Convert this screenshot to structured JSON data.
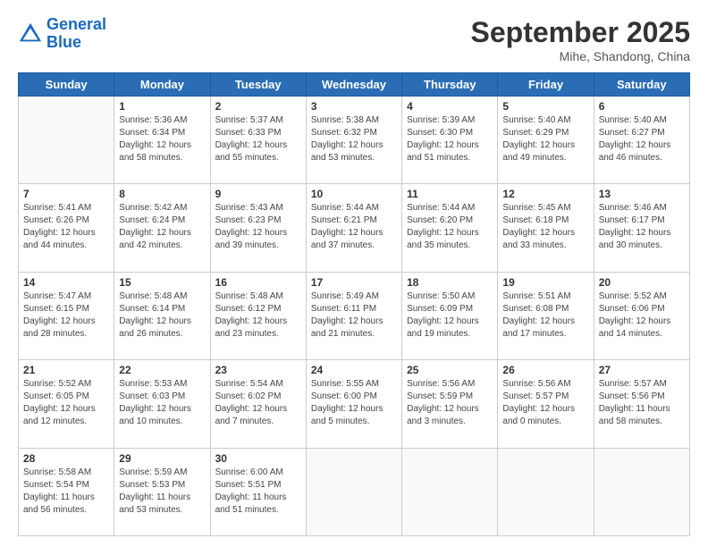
{
  "logo": {
    "line1": "General",
    "line2": "Blue"
  },
  "header": {
    "month": "September 2025",
    "location": "Mihe, Shandong, China"
  },
  "weekdays": [
    "Sunday",
    "Monday",
    "Tuesday",
    "Wednesday",
    "Thursday",
    "Friday",
    "Saturday"
  ],
  "weeks": [
    [
      {
        "day": "",
        "sunrise": "",
        "sunset": "",
        "daylight": ""
      },
      {
        "day": "1",
        "sunrise": "Sunrise: 5:36 AM",
        "sunset": "Sunset: 6:34 PM",
        "daylight": "Daylight: 12 hours and 58 minutes."
      },
      {
        "day": "2",
        "sunrise": "Sunrise: 5:37 AM",
        "sunset": "Sunset: 6:33 PM",
        "daylight": "Daylight: 12 hours and 55 minutes."
      },
      {
        "day": "3",
        "sunrise": "Sunrise: 5:38 AM",
        "sunset": "Sunset: 6:32 PM",
        "daylight": "Daylight: 12 hours and 53 minutes."
      },
      {
        "day": "4",
        "sunrise": "Sunrise: 5:39 AM",
        "sunset": "Sunset: 6:30 PM",
        "daylight": "Daylight: 12 hours and 51 minutes."
      },
      {
        "day": "5",
        "sunrise": "Sunrise: 5:40 AM",
        "sunset": "Sunset: 6:29 PM",
        "daylight": "Daylight: 12 hours and 49 minutes."
      },
      {
        "day": "6",
        "sunrise": "Sunrise: 5:40 AM",
        "sunset": "Sunset: 6:27 PM",
        "daylight": "Daylight: 12 hours and 46 minutes."
      }
    ],
    [
      {
        "day": "7",
        "sunrise": "Sunrise: 5:41 AM",
        "sunset": "Sunset: 6:26 PM",
        "daylight": "Daylight: 12 hours and 44 minutes."
      },
      {
        "day": "8",
        "sunrise": "Sunrise: 5:42 AM",
        "sunset": "Sunset: 6:24 PM",
        "daylight": "Daylight: 12 hours and 42 minutes."
      },
      {
        "day": "9",
        "sunrise": "Sunrise: 5:43 AM",
        "sunset": "Sunset: 6:23 PM",
        "daylight": "Daylight: 12 hours and 39 minutes."
      },
      {
        "day": "10",
        "sunrise": "Sunrise: 5:44 AM",
        "sunset": "Sunset: 6:21 PM",
        "daylight": "Daylight: 12 hours and 37 minutes."
      },
      {
        "day": "11",
        "sunrise": "Sunrise: 5:44 AM",
        "sunset": "Sunset: 6:20 PM",
        "daylight": "Daylight: 12 hours and 35 minutes."
      },
      {
        "day": "12",
        "sunrise": "Sunrise: 5:45 AM",
        "sunset": "Sunset: 6:18 PM",
        "daylight": "Daylight: 12 hours and 33 minutes."
      },
      {
        "day": "13",
        "sunrise": "Sunrise: 5:46 AM",
        "sunset": "Sunset: 6:17 PM",
        "daylight": "Daylight: 12 hours and 30 minutes."
      }
    ],
    [
      {
        "day": "14",
        "sunrise": "Sunrise: 5:47 AM",
        "sunset": "Sunset: 6:15 PM",
        "daylight": "Daylight: 12 hours and 28 minutes."
      },
      {
        "day": "15",
        "sunrise": "Sunrise: 5:48 AM",
        "sunset": "Sunset: 6:14 PM",
        "daylight": "Daylight: 12 hours and 26 minutes."
      },
      {
        "day": "16",
        "sunrise": "Sunrise: 5:48 AM",
        "sunset": "Sunset: 6:12 PM",
        "daylight": "Daylight: 12 hours and 23 minutes."
      },
      {
        "day": "17",
        "sunrise": "Sunrise: 5:49 AM",
        "sunset": "Sunset: 6:11 PM",
        "daylight": "Daylight: 12 hours and 21 minutes."
      },
      {
        "day": "18",
        "sunrise": "Sunrise: 5:50 AM",
        "sunset": "Sunset: 6:09 PM",
        "daylight": "Daylight: 12 hours and 19 minutes."
      },
      {
        "day": "19",
        "sunrise": "Sunrise: 5:51 AM",
        "sunset": "Sunset: 6:08 PM",
        "daylight": "Daylight: 12 hours and 17 minutes."
      },
      {
        "day": "20",
        "sunrise": "Sunrise: 5:52 AM",
        "sunset": "Sunset: 6:06 PM",
        "daylight": "Daylight: 12 hours and 14 minutes."
      }
    ],
    [
      {
        "day": "21",
        "sunrise": "Sunrise: 5:52 AM",
        "sunset": "Sunset: 6:05 PM",
        "daylight": "Daylight: 12 hours and 12 minutes."
      },
      {
        "day": "22",
        "sunrise": "Sunrise: 5:53 AM",
        "sunset": "Sunset: 6:03 PM",
        "daylight": "Daylight: 12 hours and 10 minutes."
      },
      {
        "day": "23",
        "sunrise": "Sunrise: 5:54 AM",
        "sunset": "Sunset: 6:02 PM",
        "daylight": "Daylight: 12 hours and 7 minutes."
      },
      {
        "day": "24",
        "sunrise": "Sunrise: 5:55 AM",
        "sunset": "Sunset: 6:00 PM",
        "daylight": "Daylight: 12 hours and 5 minutes."
      },
      {
        "day": "25",
        "sunrise": "Sunrise: 5:56 AM",
        "sunset": "Sunset: 5:59 PM",
        "daylight": "Daylight: 12 hours and 3 minutes."
      },
      {
        "day": "26",
        "sunrise": "Sunrise: 5:56 AM",
        "sunset": "Sunset: 5:57 PM",
        "daylight": "Daylight: 12 hours and 0 minutes."
      },
      {
        "day": "27",
        "sunrise": "Sunrise: 5:57 AM",
        "sunset": "Sunset: 5:56 PM",
        "daylight": "Daylight: 11 hours and 58 minutes."
      }
    ],
    [
      {
        "day": "28",
        "sunrise": "Sunrise: 5:58 AM",
        "sunset": "Sunset: 5:54 PM",
        "daylight": "Daylight: 11 hours and 56 minutes."
      },
      {
        "day": "29",
        "sunrise": "Sunrise: 5:59 AM",
        "sunset": "Sunset: 5:53 PM",
        "daylight": "Daylight: 11 hours and 53 minutes."
      },
      {
        "day": "30",
        "sunrise": "Sunrise: 6:00 AM",
        "sunset": "Sunset: 5:51 PM",
        "daylight": "Daylight: 11 hours and 51 minutes."
      },
      {
        "day": "",
        "sunrise": "",
        "sunset": "",
        "daylight": ""
      },
      {
        "day": "",
        "sunrise": "",
        "sunset": "",
        "daylight": ""
      },
      {
        "day": "",
        "sunrise": "",
        "sunset": "",
        "daylight": ""
      },
      {
        "day": "",
        "sunrise": "",
        "sunset": "",
        "daylight": ""
      }
    ]
  ]
}
